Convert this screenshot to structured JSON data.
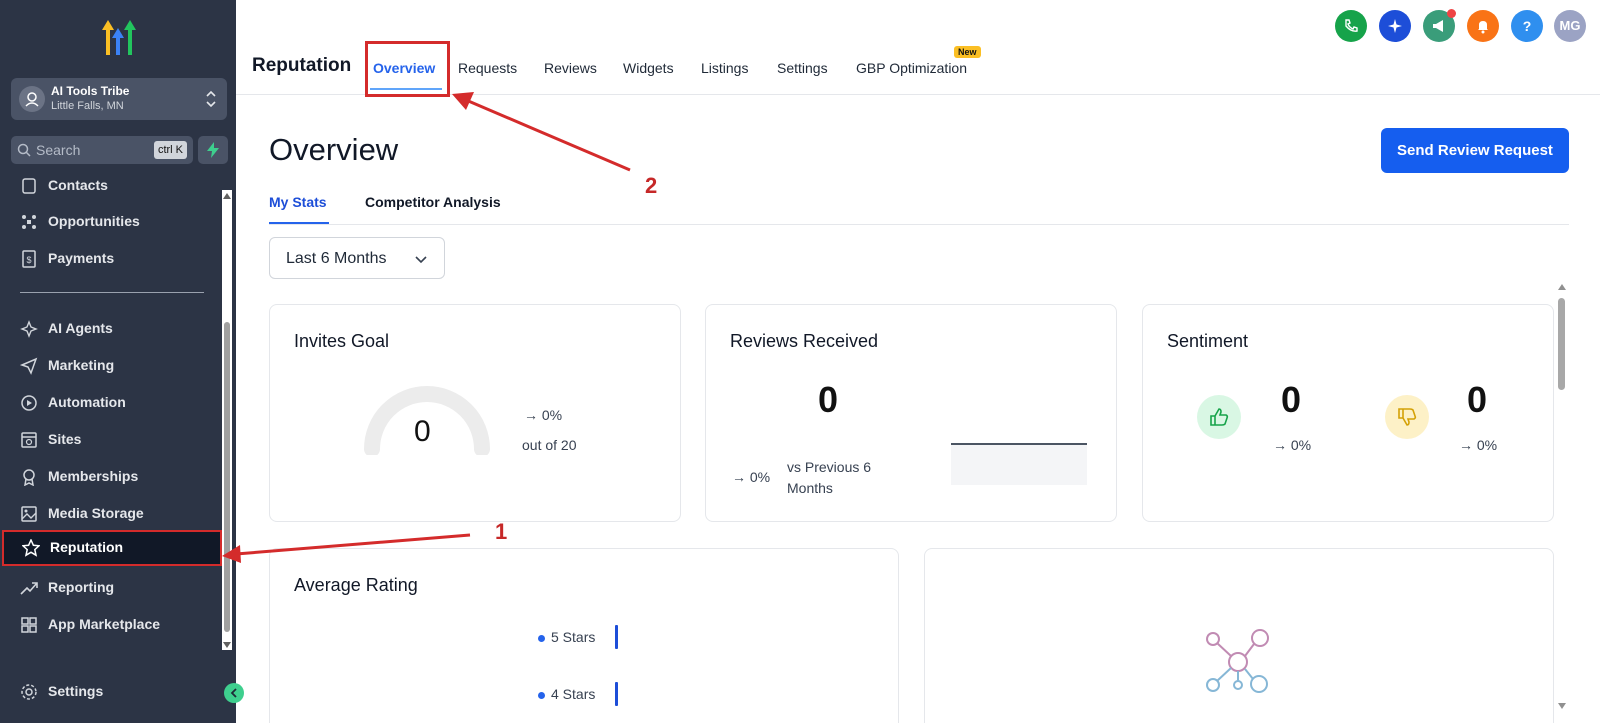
{
  "sidebar": {
    "account": {
      "name": "AI Tools Tribe",
      "location": "Little Falls, MN"
    },
    "search": {
      "placeholder": "Search",
      "shortcut": "ctrl K"
    },
    "items": [
      {
        "label": "Contacts",
        "icon": "contacts-icon"
      },
      {
        "label": "Opportunities",
        "icon": "opportunities-icon"
      },
      {
        "label": "Payments",
        "icon": "payments-icon"
      },
      {
        "label": "AI Agents",
        "icon": "ai-agents-icon"
      },
      {
        "label": "Marketing",
        "icon": "marketing-icon"
      },
      {
        "label": "Automation",
        "icon": "automation-icon"
      },
      {
        "label": "Sites",
        "icon": "sites-icon"
      },
      {
        "label": "Memberships",
        "icon": "memberships-icon"
      },
      {
        "label": "Media Storage",
        "icon": "media-storage-icon"
      },
      {
        "label": "Reputation",
        "icon": "star-icon",
        "active": true
      },
      {
        "label": "Reporting",
        "icon": "reporting-icon"
      },
      {
        "label": "App Marketplace",
        "icon": "app-marketplace-icon"
      }
    ],
    "settings_label": "Settings"
  },
  "header": {
    "section_title": "Reputation",
    "tabs": [
      {
        "label": "Overview",
        "active": true
      },
      {
        "label": "Requests"
      },
      {
        "label": "Reviews"
      },
      {
        "label": "Widgets"
      },
      {
        "label": "Listings"
      },
      {
        "label": "Settings"
      },
      {
        "label": "GBP Optimization",
        "badge": "New"
      }
    ],
    "user_initials": "MG"
  },
  "main": {
    "title": "Overview",
    "primary_button": "Send Review Request",
    "subtabs": [
      {
        "label": "My Stats",
        "active": true
      },
      {
        "label": "Competitor Analysis"
      }
    ],
    "date_range": "Last 6 Months",
    "invites_goal": {
      "title": "Invites Goal",
      "value": "0",
      "trend": "→ 0%",
      "out_of": "out of 20"
    },
    "reviews_received": {
      "title": "Reviews Received",
      "value": "0",
      "trend": "→ 0%",
      "comparison": "vs Previous 6",
      "comparison2": "Months"
    },
    "sentiment": {
      "title": "Sentiment",
      "positive": "0",
      "positive_trend": "→ 0%",
      "negative": "0",
      "negative_trend": "→ 0%"
    },
    "average_rating": {
      "title": "Average Rating",
      "rows": [
        {
          "label": "5 Stars"
        },
        {
          "label": "4 Stars"
        }
      ]
    }
  },
  "annotations": {
    "first": "1",
    "second": "2"
  },
  "colors": {
    "sidebar_bg": "#2c3445",
    "accent": "#155eef",
    "highlight": "#d42b2b"
  }
}
